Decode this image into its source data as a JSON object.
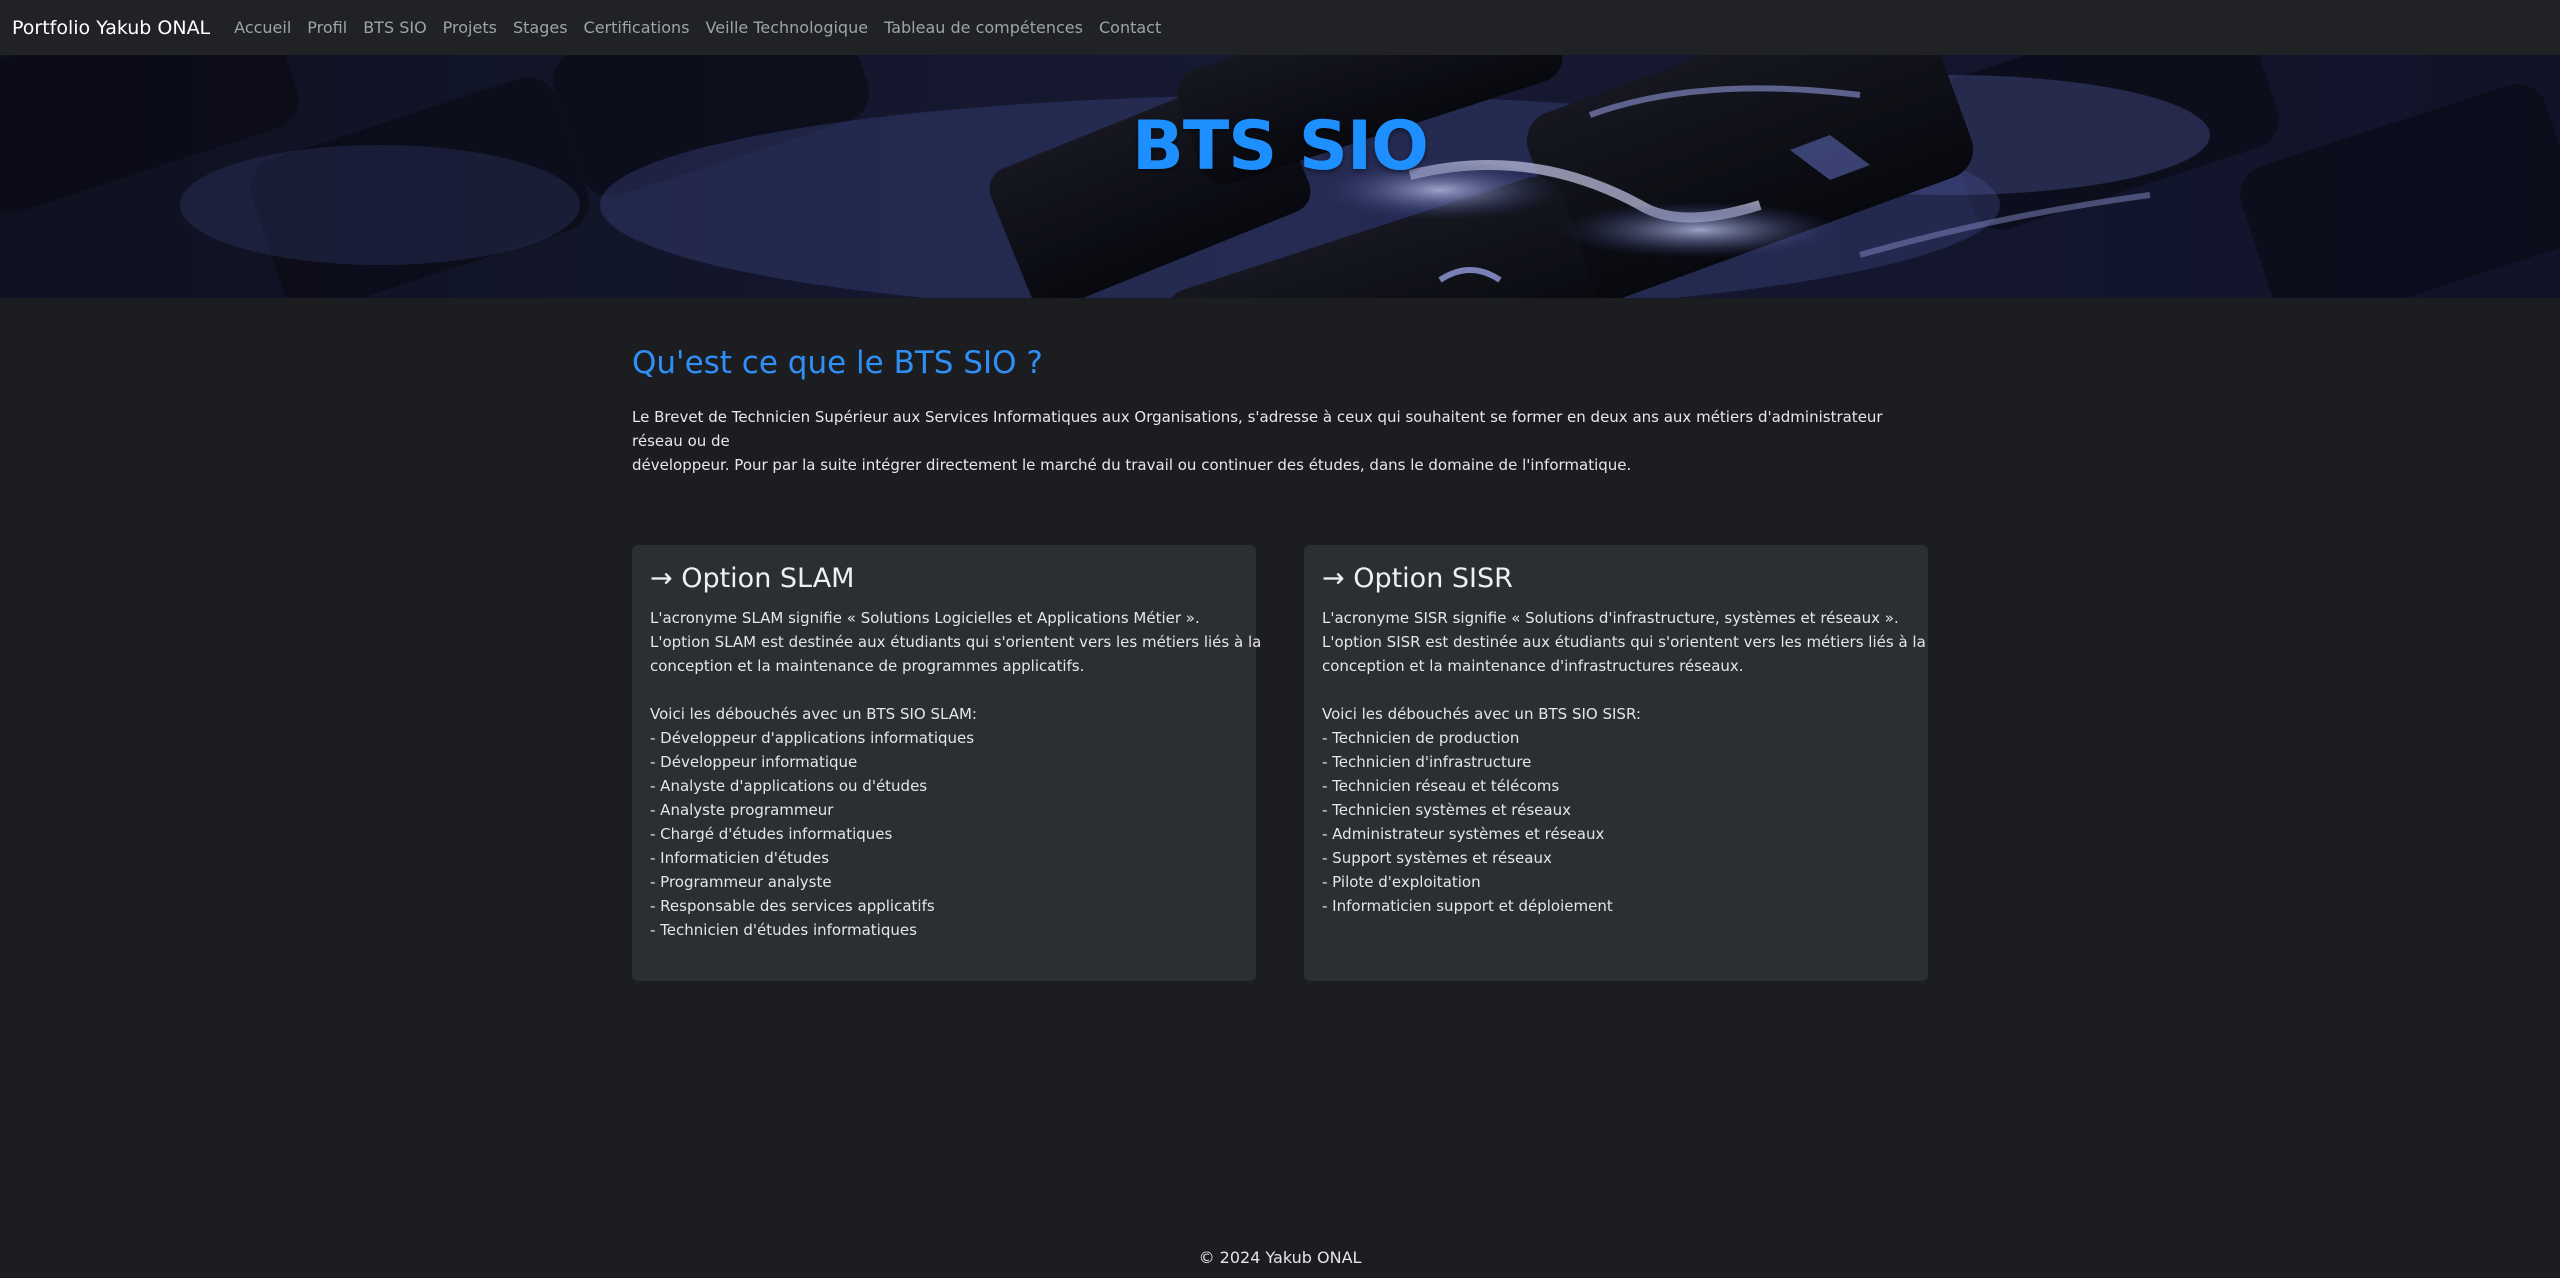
{
  "navbar": {
    "brand": "Portfolio Yakub ONAL",
    "links": [
      "Accueil",
      "Profil",
      "BTS SIO",
      "Projets",
      "Stages",
      "Certifications",
      "Veille Technologique",
      "Tableau de compétences",
      "Contact"
    ]
  },
  "hero": {
    "title": "BTS SIO",
    "title_color": "#1e8fff"
  },
  "intro": {
    "heading": "Qu'est ce que le BTS SIO ?",
    "paragraph_line1": "Le Brevet de Technicien Supérieur aux Services Informatiques aux Organisations, s'adresse à ceux qui souhaitent se former en deux ans aux métiers d'administrateur réseau ou de",
    "paragraph_line2": "développeur. Pour par la suite intégrer directement le marché du travail ou continuer des études, dans le domaine de l'informatique."
  },
  "slam": {
    "title": "→ Option SLAM",
    "desc": [
      "L'acronyme SLAM signifie « Solutions Logicielles et Applications Métier ».",
      "L'option SLAM est destinée aux étudiants qui s'orientent vers les métiers liés à la",
      "conception et la maintenance de programmes applicatifs."
    ],
    "jobs_intro": "Voici les débouchés avec un BTS SIO SLAM:",
    "jobs": [
      "- Développeur d'applications informatiques",
      "- Développeur informatique",
      "- Analyste d'applications ou d'études",
      "- Analyste programmeur",
      "- Chargé d'études informatiques",
      "- Informaticien d'études",
      "- Programmeur analyste",
      "- Responsable des services applicatifs",
      "- Technicien d'études informatiques"
    ]
  },
  "sisr": {
    "title": "→ Option SISR",
    "desc": [
      "L'acronyme SISR signifie « Solutions d'infrastructure, systèmes et réseaux ».",
      "L'option SISR est destinée aux étudiants qui s'orientent vers les métiers liés à la",
      "conception et la maintenance d'infrastructures réseaux."
    ],
    "jobs_intro": "Voici les débouchés avec un BTS SIO SISR:",
    "jobs": [
      "- Technicien de production",
      "- Technicien d'infrastructure",
      "- Technicien réseau et télécoms",
      "- Technicien systèmes et réseaux",
      "- Administrateur systèmes et réseaux",
      "- Support systèmes et réseaux",
      "- Pilote d'exploitation",
      "- Informaticien support et déploiement"
    ]
  },
  "footer": {
    "text": "© 2024 Yakub ONAL"
  }
}
